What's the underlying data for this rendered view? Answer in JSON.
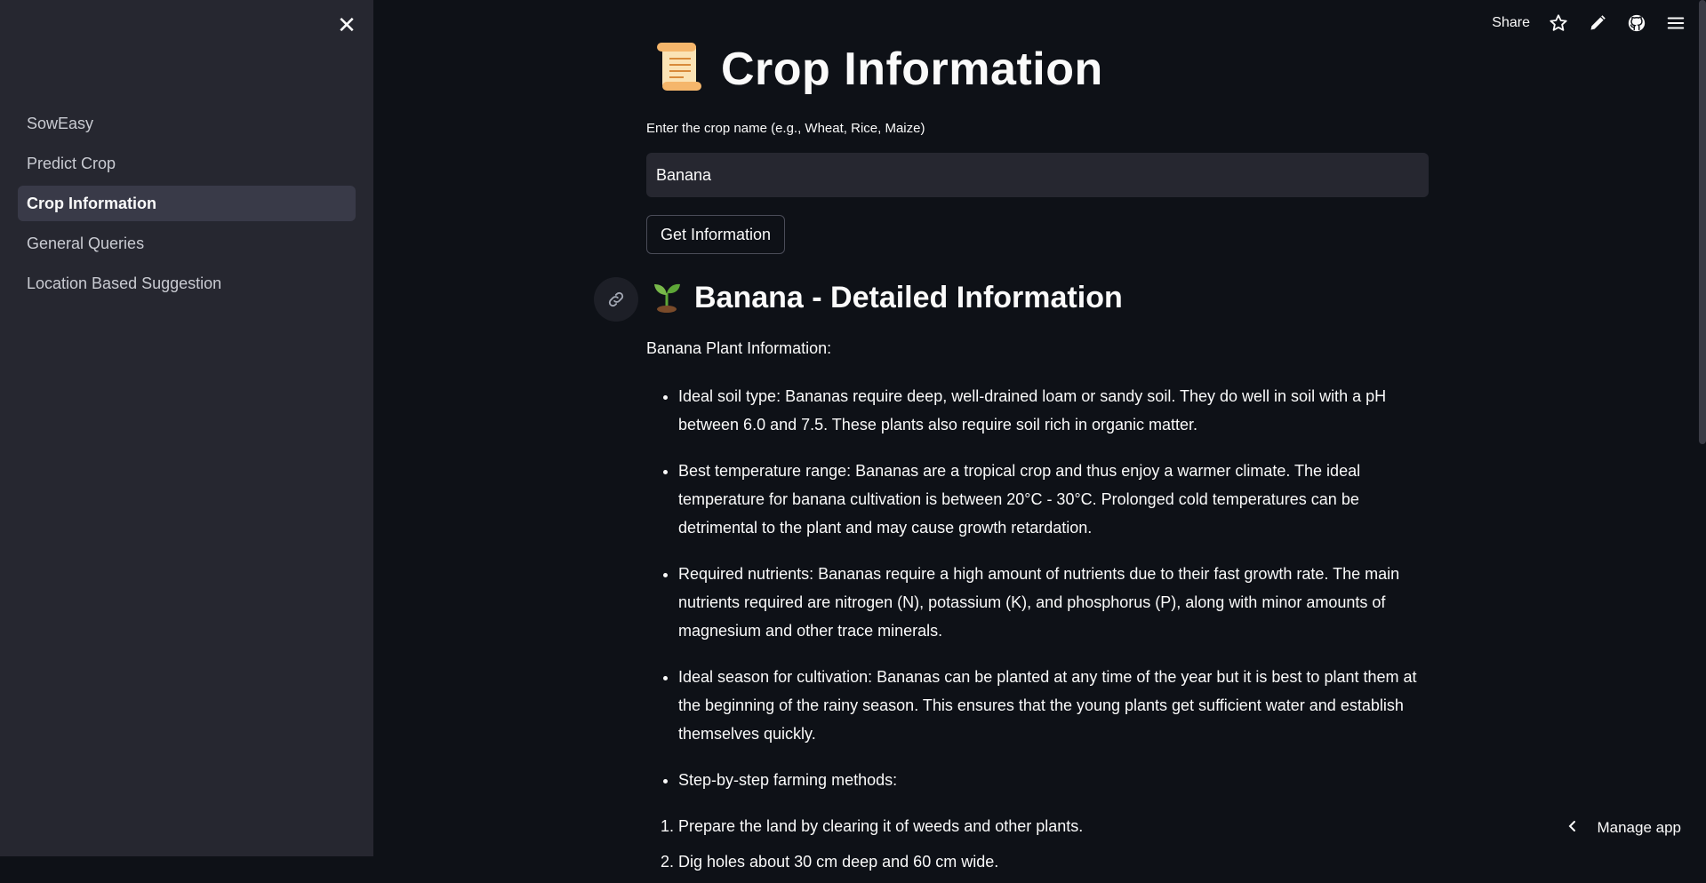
{
  "sidebar": {
    "items": [
      {
        "label": "SowEasy"
      },
      {
        "label": "Predict Crop"
      },
      {
        "label": "Crop Information"
      },
      {
        "label": "General Queries"
      },
      {
        "label": "Location Based Suggestion"
      }
    ],
    "active": "Crop Information"
  },
  "topbar": {
    "share_label": "Share"
  },
  "page": {
    "title": "Crop Information",
    "input_label": "Enter the crop name (e.g., Wheat, Rice, Maize)",
    "input_value": "Banana",
    "button_label": "Get Information",
    "subheader": "Banana - Detailed Information",
    "intro": "Banana Plant Information:",
    "bullets": [
      "Ideal soil type: Bananas require deep, well-drained loam or sandy soil. They do well in soil with a pH between 6.0 and 7.5. These plants also require soil rich in organic matter.",
      "Best temperature range: Bananas are a tropical crop and thus enjoy a warmer climate. The ideal temperature for banana cultivation is between 20°C - 30°C. Prolonged cold temperatures can be detrimental to the plant and may cause growth retardation.",
      "Required nutrients: Bananas require a high amount of nutrients due to their fast growth rate. The main nutrients required are nitrogen (N), potassium (K), and phosphorus (P), along with minor amounts of magnesium and other trace minerals.",
      "Ideal season for cultivation: Bananas can be planted at any time of the year but it is best to plant them at the beginning of the rainy season. This ensures that the young plants get sufficient water and establish themselves quickly.",
      "Step-by-step farming methods:"
    ],
    "steps": [
      "Prepare the land by clearing it of weeds and other plants.",
      "Dig holes about 30 cm deep and 60 cm wide."
    ]
  },
  "footer": {
    "manage_label": "Manage app"
  },
  "colors": {
    "background": "#0e1117",
    "sidebar": "#262730",
    "active_item": "#393a48",
    "text": "#fafafa"
  }
}
